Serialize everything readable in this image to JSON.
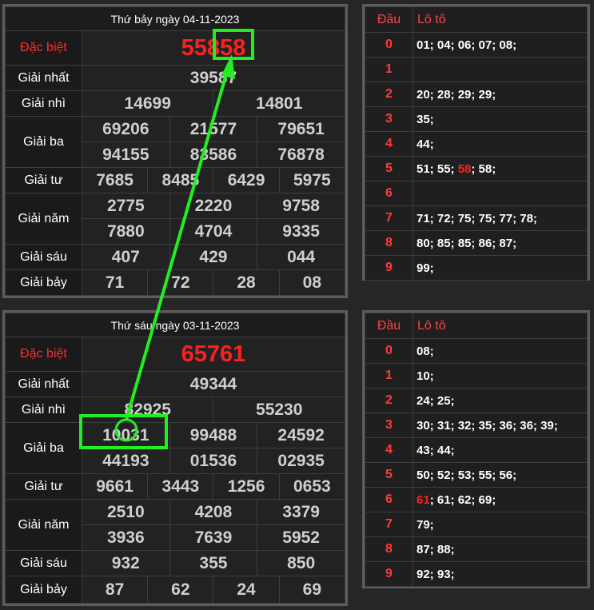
{
  "top": {
    "title": "Thứ bảy ngày 04-11-2023",
    "special_label": "Đặc biệt",
    "special_prefix": "558",
    "special_suffix": "58",
    "rows": [
      {
        "label": "Giải nhất",
        "values": [
          [
            "39587"
          ]
        ]
      },
      {
        "label": "Giải nhì",
        "values": [
          [
            "14699",
            "14801"
          ]
        ]
      },
      {
        "label": "Giải ba",
        "values": [
          [
            "69206",
            "21577",
            "79651"
          ],
          [
            "94155",
            "83586",
            "76878"
          ]
        ]
      },
      {
        "label": "Giải tư",
        "values": [
          [
            "7685",
            "8485",
            "6429",
            "5975"
          ]
        ]
      },
      {
        "label": "Giải năm",
        "values": [
          [
            "2775",
            "2220",
            "9758"
          ],
          [
            "7880",
            "4704",
            "9335"
          ]
        ]
      },
      {
        "label": "Giải sáu",
        "values": [
          [
            "407",
            "429",
            "044"
          ]
        ]
      },
      {
        "label": "Giải bảy",
        "values": [
          [
            "71",
            "72",
            "28",
            "08"
          ]
        ]
      }
    ],
    "loto": {
      "head_label": "Đầu",
      "value_label": "Lô tô",
      "rows": [
        {
          "d": "0",
          "parts": [
            {
              "t": "01; 04; 06; 07; 08;"
            }
          ]
        },
        {
          "d": "1",
          "parts": []
        },
        {
          "d": "2",
          "parts": [
            {
              "t": "20; 28; 29; 29;"
            }
          ]
        },
        {
          "d": "3",
          "parts": [
            {
              "t": "35;"
            }
          ]
        },
        {
          "d": "4",
          "parts": [
            {
              "t": "44;"
            }
          ]
        },
        {
          "d": "5",
          "parts": [
            {
              "t": "51; 55; "
            },
            {
              "t": "58",
              "hl": true
            },
            {
              "t": "; 58;"
            }
          ]
        },
        {
          "d": "6",
          "parts": []
        },
        {
          "d": "7",
          "parts": [
            {
              "t": "71; 72; 75; 75; 77; 78;"
            }
          ]
        },
        {
          "d": "8",
          "parts": [
            {
              "t": "80; 85; 85; 86; 87;"
            }
          ]
        },
        {
          "d": "9",
          "parts": [
            {
              "t": "99;"
            }
          ]
        }
      ]
    }
  },
  "bottom": {
    "title": "Thứ sáu ngày 03-11-2023",
    "special_label": "Đặc biệt",
    "special_prefix": "65761",
    "special_suffix": "",
    "rows": [
      {
        "label": "Giải nhất",
        "values": [
          [
            "49344"
          ]
        ]
      },
      {
        "label": "Giải nhì",
        "values": [
          [
            "82925",
            "55230"
          ]
        ]
      },
      {
        "label": "Giải ba",
        "values": [
          [
            "10031",
            "99488",
            "24592"
          ],
          [
            "44193",
            "01536",
            "02935"
          ]
        ]
      },
      {
        "label": "Giải tư",
        "values": [
          [
            "9661",
            "3443",
            "1256",
            "0653"
          ]
        ]
      },
      {
        "label": "Giải năm",
        "values": [
          [
            "2510",
            "4208",
            "3379"
          ],
          [
            "3936",
            "7639",
            "5952"
          ]
        ]
      },
      {
        "label": "Giải sáu",
        "values": [
          [
            "932",
            "355",
            "850"
          ]
        ]
      },
      {
        "label": "Giải bảy",
        "values": [
          [
            "87",
            "62",
            "24",
            "69"
          ]
        ]
      }
    ],
    "loto": {
      "head_label": "Đầu",
      "value_label": "Lô tô",
      "rows": [
        {
          "d": "0",
          "parts": [
            {
              "t": "08;"
            }
          ]
        },
        {
          "d": "1",
          "parts": [
            {
              "t": "10;"
            }
          ]
        },
        {
          "d": "2",
          "parts": [
            {
              "t": "24; 25;"
            }
          ]
        },
        {
          "d": "3",
          "parts": [
            {
              "t": "30; 31; 32; 35; 36; 36; 39;"
            }
          ]
        },
        {
          "d": "4",
          "parts": [
            {
              "t": "43; 44;"
            }
          ]
        },
        {
          "d": "5",
          "parts": [
            {
              "t": "50; 52; 53; 55; 56;"
            }
          ]
        },
        {
          "d": "6",
          "parts": [
            {
              "t": "61",
              "hl": true
            },
            {
              "t": "; 61; 62; 69;"
            }
          ]
        },
        {
          "d": "7",
          "parts": [
            {
              "t": "79;"
            }
          ]
        },
        {
          "d": "8",
          "parts": [
            {
              "t": "87; 88;"
            }
          ]
        },
        {
          "d": "9",
          "parts": [
            {
              "t": "92; 93;"
            }
          ]
        }
      ]
    }
  },
  "colors": {
    "highlight_green": "#22ee22",
    "special_red": "#ff1f1f",
    "header_red": "#ff4040"
  }
}
